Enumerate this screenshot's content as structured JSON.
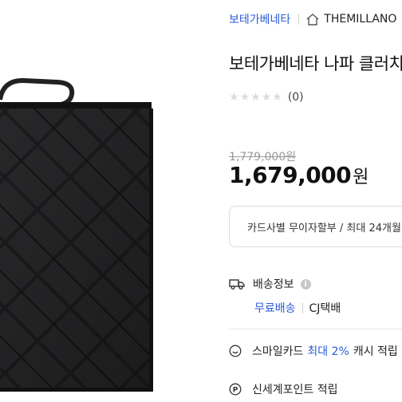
{
  "breadcrumb": {
    "brand": "보테가베네타",
    "store": "THEMILLANO"
  },
  "product": {
    "title": "보테가베네타 나파 클러치",
    "rating_count": "(0)",
    "stars_filled": 0,
    "stars_total": 5,
    "original_price": "1,779,000원",
    "price_value": "1,679,000",
    "price_unit": "원"
  },
  "installment": {
    "text": "카드사별 무이자할부 / 최대 24개월"
  },
  "shipping": {
    "label": "배송정보",
    "info_icon": "i",
    "free_label": "무료배송",
    "carrier": "CJ택배"
  },
  "smile_card": {
    "prefix": "스마일카드",
    "highlight": "최대 2%",
    "suffix": "캐시 적립"
  },
  "points": {
    "label": "신세계포인트 적립"
  },
  "colors": {
    "accent": "#2c5bd6",
    "bag": "#1f1f21"
  }
}
